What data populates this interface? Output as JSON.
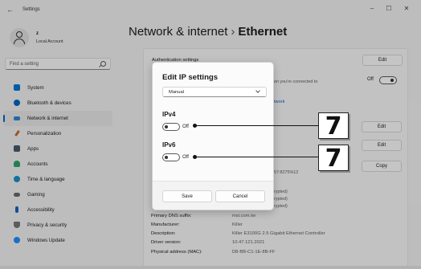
{
  "titlebar": {
    "back": "←",
    "title": "Settings",
    "minimize": "–",
    "maximize": "☐",
    "close": "✕"
  },
  "account": {
    "name": "z",
    "type": "Local Account"
  },
  "search": {
    "placeholder": "Find a setting"
  },
  "sidebar": {
    "items": [
      {
        "label": "System",
        "color": "#0078d4"
      },
      {
        "label": "Bluetooth & devices",
        "color": "#0067c0"
      },
      {
        "label": "Network & internet",
        "color": "#2b88d8"
      },
      {
        "label": "Personalization",
        "color": "#c96a2b"
      },
      {
        "label": "Apps",
        "color": "#4a5a6a"
      },
      {
        "label": "Accounts",
        "color": "#2fa36b"
      },
      {
        "label": "Time & language",
        "color": "#1e90c8"
      },
      {
        "label": "Gaming",
        "color": "#6a6a6a"
      },
      {
        "label": "Accessibility",
        "color": "#1f5fbf"
      },
      {
        "label": "Privacy & security",
        "color": "#777777"
      },
      {
        "label": "Windows Update",
        "color": "#1e90ff"
      }
    ]
  },
  "header": {
    "parent": "Network & internet",
    "separator": "›",
    "current": "Ethernet"
  },
  "content": {
    "auth_settings": "Authentication settings",
    "edit": "Edit",
    "metered_note": "en you're connected to",
    "toggle_off": "Off",
    "network_link": "twork",
    "copy": "Copy",
    "ipv6_fragment": "57:8275%12",
    "encrypted_1": "rypted)",
    "encrypted_2": "rypted)",
    "encrypted_3": "rypted)",
    "properties": [
      {
        "label": "Primary DNS suffix:",
        "value": "msi.com.tw"
      },
      {
        "label": "Manufacturer:",
        "value": "Killer"
      },
      {
        "label": "Description:",
        "value": "Killer E3100G 2.5 Gigabit Ethernet Controller"
      },
      {
        "label": "Driver version:",
        "value": "10.47.121.2021"
      },
      {
        "label": "Physical address (MAC):",
        "value": "D8-BB-C1-1E-8B-FF"
      }
    ]
  },
  "dialog": {
    "title": "Edit IP settings",
    "mode": "Manual",
    "ipv4_heading": "IPv4",
    "ipv4_state": "Off",
    "ipv6_heading": "IPv6",
    "ipv6_state": "Off",
    "save": "Save",
    "cancel": "Cancel"
  },
  "callouts": [
    {
      "number": "7"
    },
    {
      "number": "7"
    }
  ]
}
